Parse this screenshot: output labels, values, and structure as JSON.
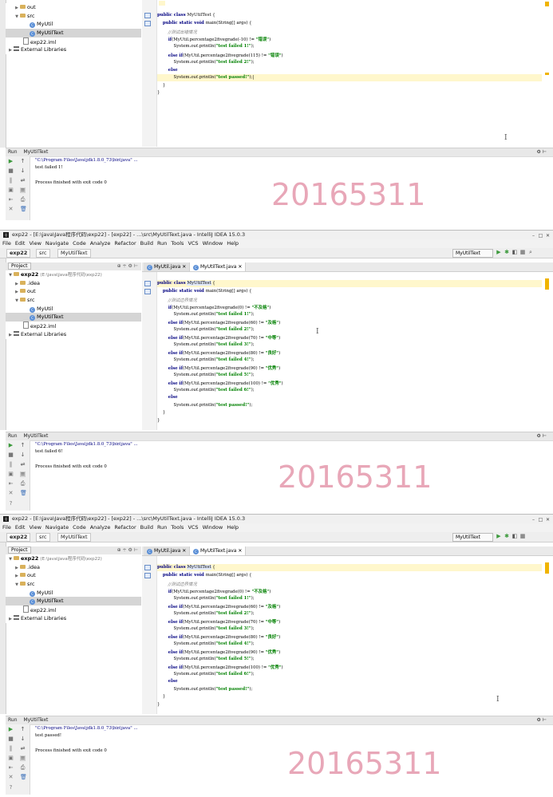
{
  "app": {
    "title": "exp22 - [E:\\java\\Java程序代码\\exp22] - [exp22] - ...\\src\\MyUtilText.java - IntelliJ IDEA 15.0.3",
    "menu": [
      "File",
      "Edit",
      "View",
      "Navigate",
      "Code",
      "Analyze",
      "Refactor",
      "Build",
      "Run",
      "Tools",
      "VCS",
      "Window",
      "Help"
    ],
    "breadcrumbs": [
      "exp22",
      "src",
      "MyUtilText"
    ],
    "run_config": "MyUtilText",
    "project_label": "Project",
    "tabs": [
      "MyUtil.java",
      "MyUtilText.java"
    ]
  },
  "tree": {
    "root": "exp22",
    "root_path": "(E:\\java\\Java程序代码\\exp22)",
    "idea": ".idea",
    "out": "out",
    "src": "src",
    "myutil": "MyUtil",
    "myutiltext": "MyUtilText",
    "iml": "exp22.iml",
    "libs": "External Libraries"
  },
  "code_short": [
    "public class MyUtilTest {",
    "    public static void main(String[] args) {",
    "        //测试出错情况",
    "        if(MyUtil.percentage2fivegrade(-10) != \"错误\")",
    "            System.out.println(\"test failed 1!\");",
    "        else if(MyUtil.percentage2fivegrade(115) != \"错误\")",
    "            System.out.println(\"test failed 2!\");",
    "        else",
    "            System.out.println(\"test passed!\");",
    "    }",
    "}"
  ],
  "code_long": [
    "public class MyUtilTest {",
    "    public static void main(String[] args) {",
    "        //测试边界情况",
    "        if(MyUtil.percentage2fivegrade(0) != \"不及格\")",
    "            System.out.println(\"test failed 1!\");",
    "        else if(MyUtil.percentage2fivegrade(60) != \"及格\")",
    "            System.out.println(\"test failed 2!\");",
    "        else if(MyUtil.percentage2fivegrade(70) != \"中等\")",
    "            System.out.println(\"test failed 3!\");",
    "        else if(MyUtil.percentage2fivegrade(80) != \"良好\")",
    "            System.out.println(\"test failed 4!\");",
    "        else if(MyUtil.percentage2fivegrade(90) != \"优秀\")",
    "            System.out.println(\"test failed 5!\");",
    "        else if(MyUtil.percentage2fivegrade(100) != \"优秀\")",
    "            System.out.println(\"test failed 6!\");",
    "        else",
    "            System.out.println(\"test passed!\");",
    "    }",
    "}"
  ],
  "run": {
    "label": "Run",
    "config": "MyUtilText",
    "cmd": "\"C:\\Program Files\\Java\\jdk1.8.0_73\\bin\\java\" ...",
    "finished": "Process finished with exit code 0",
    "out1": "test failed 1!",
    "out2": "test failed 6!",
    "out3": "test passed!"
  },
  "watermark": "20165311",
  "colors": {
    "accent": "#f0b400",
    "watermark": "#e8a7b8",
    "run_green": "#3c9a3c"
  }
}
